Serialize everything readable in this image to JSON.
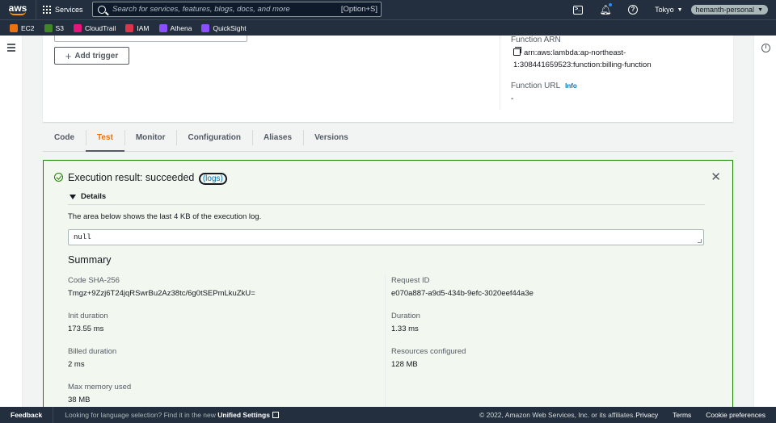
{
  "nav": {
    "logo": "aws",
    "services": "Services",
    "search_placeholder": "Search for services, features, blogs, docs, and more",
    "search_shortcut": "[Option+S]",
    "region": "Tokyo",
    "account": "hemanth-personal"
  },
  "bookmarks": [
    {
      "label": "EC2",
      "color": "#ec7211"
    },
    {
      "label": "S3",
      "color": "#3f8624"
    },
    {
      "label": "CloudTrail",
      "color": "#e7157b"
    },
    {
      "label": "IAM",
      "color": "#dd344c"
    },
    {
      "label": "Athena",
      "color": "#8c4fff"
    },
    {
      "label": "QuickSight",
      "color": "#8c4fff"
    }
  ],
  "function_overview": {
    "add_trigger": "Add trigger",
    "arn_label": "Function ARN",
    "arn_value": "arn:aws:lambda:ap-northeast-1:308441659523:function:billing-function",
    "url_label": "Function URL",
    "url_info": "Info",
    "url_value": "-"
  },
  "tabs": [
    "Code",
    "Test",
    "Monitor",
    "Configuration",
    "Aliases",
    "Versions"
  ],
  "active_tab": "Test",
  "result": {
    "title": "Execution result: succeeded",
    "logs_link": "(logs)",
    "details_label": "Details",
    "description": "The area below shows the last 4 KB of the execution log.",
    "log_output": "null",
    "summary_title": "Summary",
    "left": [
      {
        "label": "Code SHA-256",
        "value": "Tmgz+9Zzj6T24jqRSwrBu2Az38tc/6g0tSEPmLkuZkU="
      },
      {
        "label": "Init duration",
        "value": "173.55 ms"
      },
      {
        "label": "Billed duration",
        "value": "2 ms"
      },
      {
        "label": "Max memory used",
        "value": "38 MB"
      }
    ],
    "right": [
      {
        "label": "Request ID",
        "value": "e070a887-a9d5-434b-9efc-3020eef44a3e"
      },
      {
        "label": "Duration",
        "value": "1.33 ms"
      },
      {
        "label": "Resources configured",
        "value": "128 MB"
      }
    ]
  },
  "footer": {
    "feedback": "Feedback",
    "lang_text": "Looking for language selection? Find it in the new",
    "lang_link": "Unified Settings",
    "copyright": "© 2022, Amazon Web Services, Inc. or its affiliates.",
    "links": [
      "Privacy",
      "Terms",
      "Cookie preferences"
    ]
  }
}
